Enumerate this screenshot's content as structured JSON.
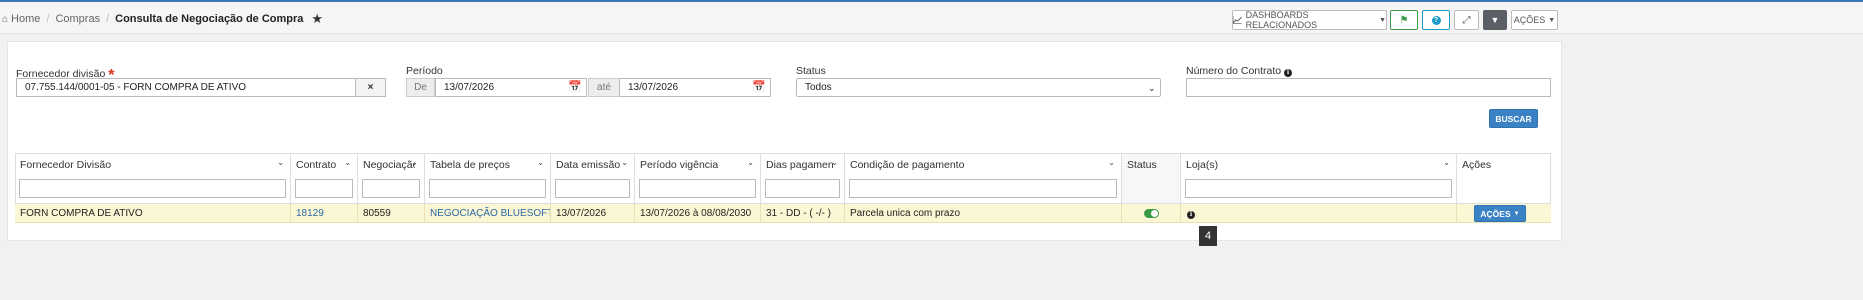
{
  "breadcrumb": {
    "home": "Home",
    "compras": "Compras",
    "current": "Consulta de Negociação de Compra"
  },
  "toolbar": {
    "dashboards_label": "DASHBOARDS RELACIONADOS",
    "acoes_label": "AÇÕES"
  },
  "filters": {
    "fornecedor_label": "Fornecedor divisão",
    "required_mark": "*",
    "fornecedor_value": "07.755.144/0001-05 - FORN COMPRA DE ATIVO",
    "clear_symbol": "×",
    "periodo_label": "Período",
    "de_label": "De",
    "de_value": "13/07/2026",
    "ate_label": "até",
    "ate_value": "13/07/2026",
    "status_label": "Status",
    "status_value": "Todos",
    "contrato_label": "Número do Contrato",
    "buscar_label": "BUSCAR"
  },
  "table": {
    "columns": [
      "Fornecedor Divisão",
      "Contrato",
      "Negociação",
      "Tabela de preços",
      "Data emissão",
      "Período vigência",
      "Dias pagamento",
      "Condição de pagamento",
      "Status",
      "Loja(s)",
      "Ações"
    ],
    "rows": [
      {
        "fornecedor": "FORN COMPRA DE ATIVO",
        "contrato": "18129",
        "negociacao": "80559",
        "tabela": "NEGOCIAÇÃO BLUESOFT",
        "data_emissao": "13/07/2026",
        "periodo": "13/07/2026 à 08/08/2030",
        "dias": "31 - DD - ( -/- )",
        "condicao": "Parcela unica com prazo",
        "status": "active",
        "acoes_label": "AÇÕES"
      }
    ]
  },
  "tooltip": "4",
  "colors": {
    "accent": "#3a82c4",
    "success": "#3a9a45",
    "row_highlight": "#fbf7d4"
  }
}
